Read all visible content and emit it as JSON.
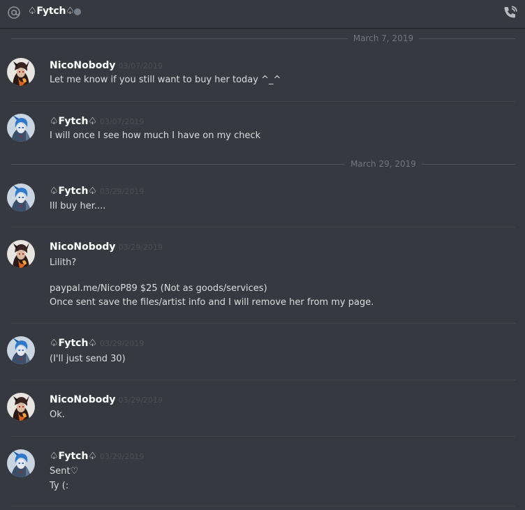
{
  "header": {
    "channel_name": "♤Fytch♤",
    "status_color": "#747f8d",
    "icons": [
      "at-icon",
      "call-icon"
    ]
  },
  "dates": [
    "March 7, 2019",
    "March 29, 2019"
  ],
  "users": {
    "nico": "NicoNobody",
    "fytch": "♤Fytch♤"
  },
  "messages": [
    {
      "author": "NicoNobody",
      "timestamp": "03/07/2019",
      "lines": [
        "Let me know if you still want to buy her today ^_^"
      ]
    },
    {
      "author": "♤Fytch♤",
      "timestamp": "03/07/2019",
      "lines": [
        "I will once I see how much I have on my check"
      ]
    },
    {
      "author": "♤Fytch♤",
      "timestamp": "03/29/2019",
      "lines": [
        "Ill buy her...."
      ]
    },
    {
      "author": "NicoNobody",
      "timestamp": "03/29/2019",
      "lines": [
        "Lilith?",
        "",
        "paypal.me/NicoP89 $25 (Not as goods/services)",
        "Once sent save the files/artist info and I will remove her from my page."
      ]
    },
    {
      "author": "♤Fytch♤",
      "timestamp": "03/29/2019",
      "lines": [
        "(I'll just send 30)"
      ]
    },
    {
      "author": "NicoNobody",
      "timestamp": "03/29/2019",
      "lines": [
        "Ok."
      ]
    },
    {
      "author": "♤Fytch♤",
      "timestamp": "03/29/2019",
      "lines": [
        "Sent♡",
        "Ty (:"
      ]
    }
  ]
}
